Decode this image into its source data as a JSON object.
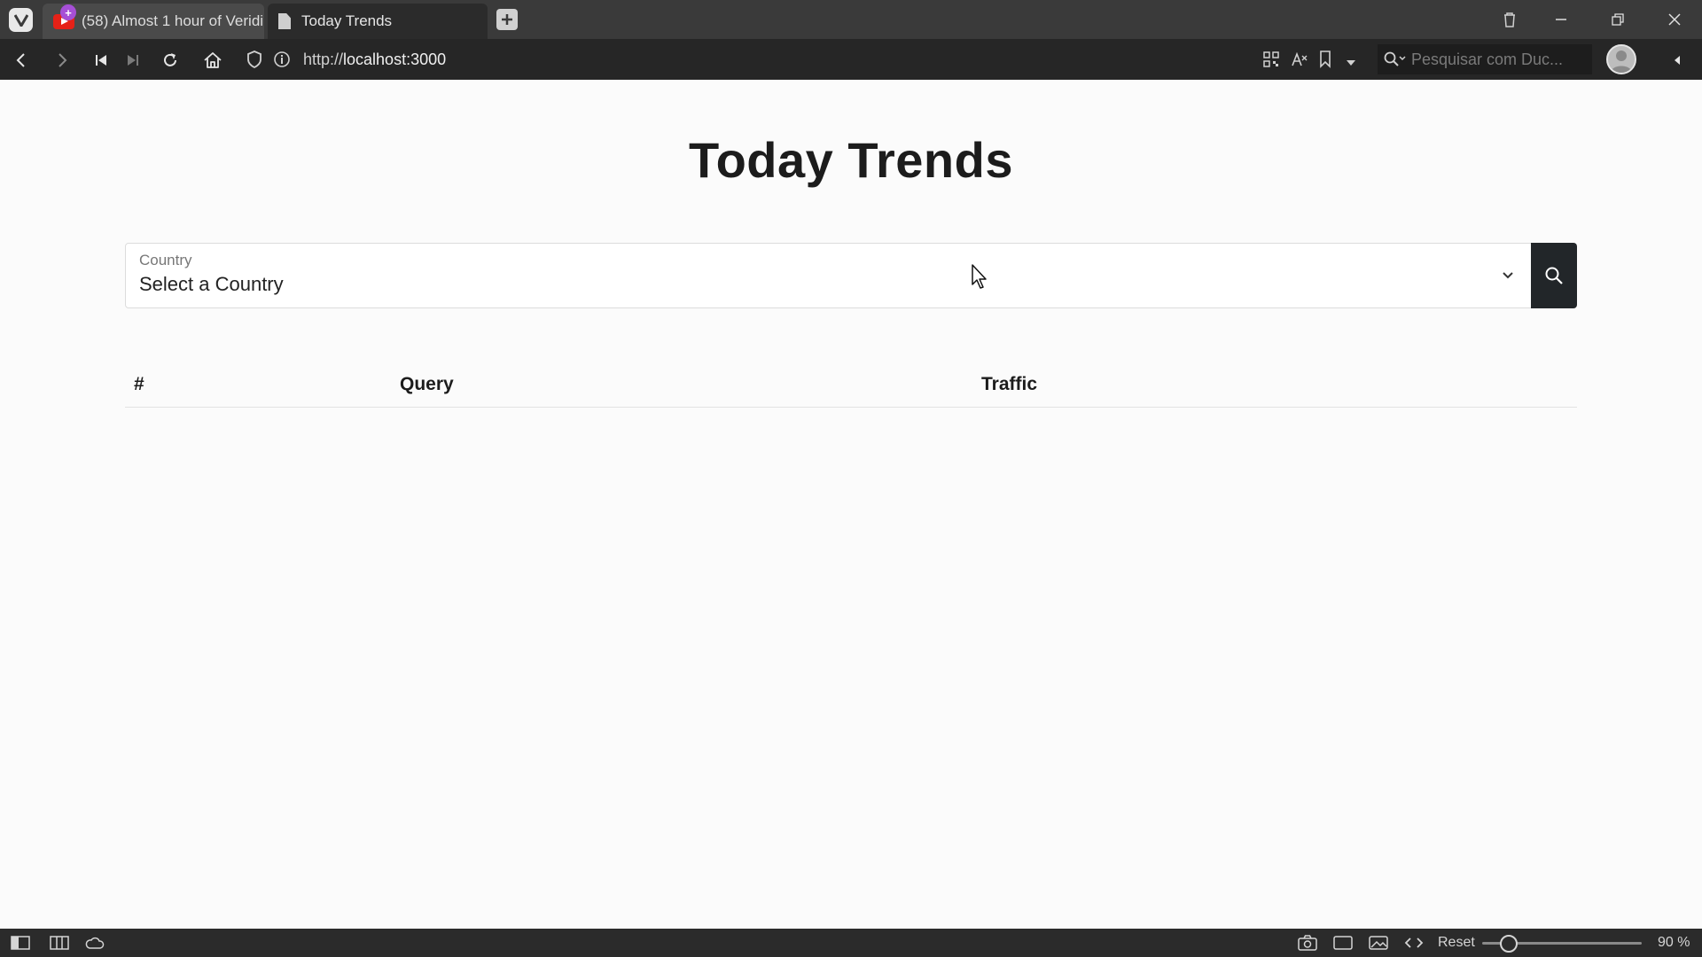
{
  "browser": {
    "tabs": [
      {
        "label": "(58) Almost 1 hour of Veridi",
        "badge": "+"
      },
      {
        "label": "Today Trends"
      }
    ],
    "url_scheme": "http://",
    "url_host": "localhost:3000",
    "search_placeholder": "Pesquisar com Duc...",
    "statusbar": {
      "reset_label": "Reset",
      "zoom": "90 %"
    }
  },
  "page": {
    "title": "Today Trends",
    "country_select": {
      "label": "Country",
      "value": "Select a Country"
    },
    "table": {
      "columns": [
        "#",
        "Query",
        "Traffic"
      ],
      "rows": []
    }
  },
  "colors": {
    "accent_dark": "#222629",
    "page_bg": "#fbfbfb",
    "chrome_bg": "#262626"
  }
}
